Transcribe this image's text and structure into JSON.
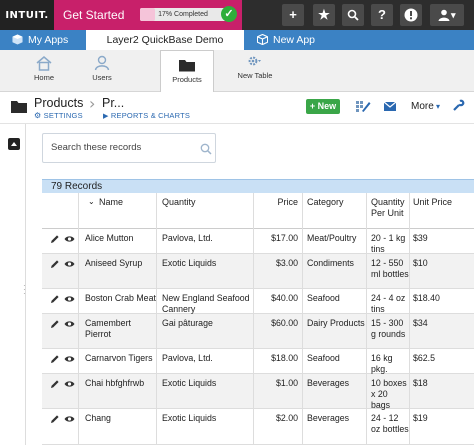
{
  "topbar": {
    "brand": "INTUIT.",
    "get_started": "Get Started",
    "progress_pct": 17,
    "progress_label": "17% Completed",
    "check_glyph": "✓",
    "buttons": [
      {
        "name": "add-icon",
        "glyph": "+"
      },
      {
        "name": "star-icon",
        "glyph": "★"
      },
      {
        "name": "search-icon",
        "glyph": "⌕"
      },
      {
        "name": "help-icon",
        "glyph": "?"
      },
      {
        "name": "alert-icon",
        "glyph": "!"
      },
      {
        "name": "user-icon",
        "glyph": "▾"
      }
    ]
  },
  "tabs": {
    "my_apps": "My Apps",
    "current_app": "Layer2 QuickBase Demo",
    "new_app": "New App"
  },
  "appnav": {
    "home": "Home",
    "users": "Users",
    "products": "Products",
    "new_table": "New Table"
  },
  "title": {
    "table": "Products",
    "breadcrumb": "Pr...",
    "settings": "SETTINGS",
    "reports": "REPORTS & CHARTS",
    "new_button": "+ New",
    "more": "More"
  },
  "search": {
    "placeholder": "Search these records"
  },
  "table": {
    "record_count": "79 Records",
    "columns": [
      "Name",
      "Quantity",
      "Price",
      "Category",
      "Quantity Per Unit",
      "Unit Price"
    ],
    "rows": [
      {
        "name": "Alice Mutton",
        "quantity": "Pavlova, Ltd.",
        "price": "$17.00",
        "category": "Meat/Poultry",
        "qpu": "20 - 1 kg tins",
        "unit_price": "$39"
      },
      {
        "name": "Aniseed Syrup",
        "quantity": "Exotic Liquids",
        "price": "$3.00",
        "category": "Condiments",
        "qpu": "12 - 550 ml bottles",
        "unit_price": "$10"
      },
      {
        "name": "Boston Crab Meat",
        "quantity": "New England Seafood Cannery",
        "price": "$40.00",
        "category": "Seafood",
        "qpu": "24 - 4 oz tins",
        "unit_price": "$18.40"
      },
      {
        "name": "Camembert Pierrot",
        "quantity": "Gai pâturage",
        "price": "$60.00",
        "category": "Dairy Products",
        "qpu": "15 - 300 g rounds",
        "unit_price": "$34"
      },
      {
        "name": "Carnarvon Tigers",
        "quantity": "Pavlova, Ltd.",
        "price": "$18.00",
        "category": "Seafood",
        "qpu": "16 kg pkg.",
        "unit_price": "$62.5"
      },
      {
        "name": "Chai hbfghfrwb",
        "quantity": "Exotic Liquids",
        "price": "$1.00",
        "category": "Beverages",
        "qpu": "10 boxes x 20 bags",
        "unit_price": "$18"
      },
      {
        "name": "Chang",
        "quantity": "Exotic Liquids",
        "price": "$2.00",
        "category": "Beverages",
        "qpu": "24 - 12 oz bottles",
        "unit_price": "$19"
      }
    ]
  }
}
